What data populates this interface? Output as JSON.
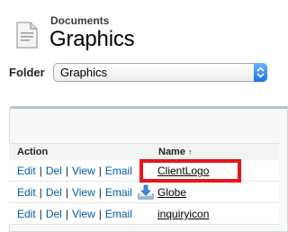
{
  "header": {
    "subtitle": "Documents",
    "title": "Graphics",
    "icon": "document-icon"
  },
  "folder": {
    "label": "Folder",
    "selected": "Graphics"
  },
  "table": {
    "columns": {
      "action": "Action",
      "name": "Name",
      "sort_indicator": "↑"
    },
    "rows": [
      {
        "actions": {
          "edit": "Edit",
          "del": "Del",
          "view": "View",
          "email": "Email"
        },
        "name": "ClientLogo",
        "icon": null
      },
      {
        "actions": {
          "edit": "Edit",
          "del": "Del",
          "view": "View",
          "email": "Email"
        },
        "name": "Globe",
        "icon": "download-tray-icon"
      },
      {
        "actions": {
          "edit": "Edit",
          "del": "Del",
          "view": "View",
          "email": "Email"
        },
        "name": "inquiryicon",
        "icon": null
      }
    ]
  },
  "colors": {
    "link": "#015ba7",
    "highlight": "#e8151b",
    "select_arrow": "#1a72e8"
  }
}
